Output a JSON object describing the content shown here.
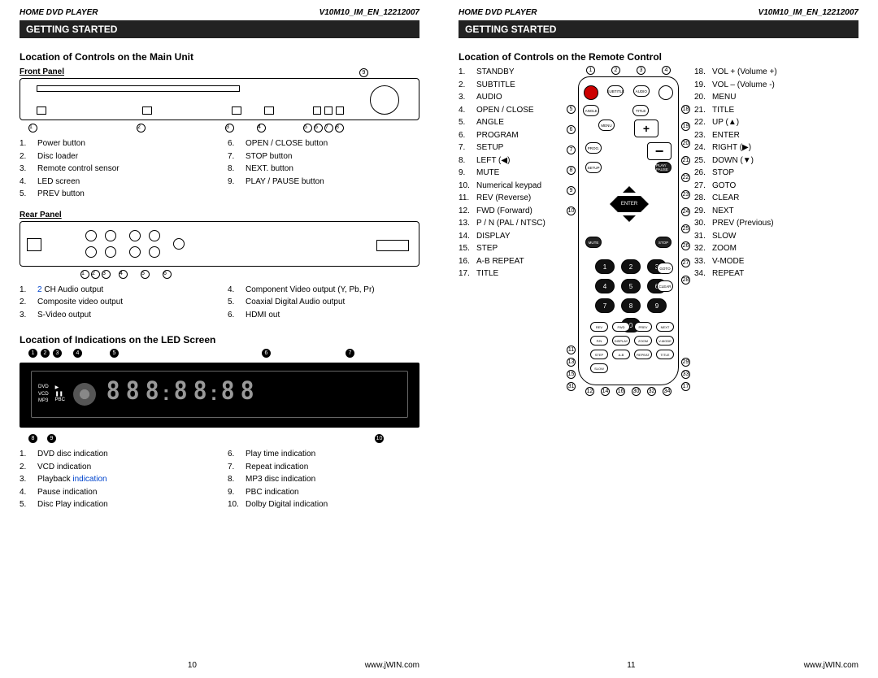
{
  "doc": {
    "product": "HOME DVD PLAYER",
    "docid": "V10M10_IM_EN_12212007",
    "band": "GETTING STARTED",
    "footer_url": "www.jWIN.com"
  },
  "left": {
    "title_main": "Location of Controls on the Main Unit",
    "front_label": "Front Panel",
    "front_list_a": [
      "Power button",
      "Disc loader",
      "Remote control sensor",
      "LED screen",
      "PREV button"
    ],
    "front_list_b": [
      "OPEN / CLOSE button",
      "STOP button",
      "NEXT. button",
      "PLAY / PAUSE button"
    ],
    "rear_label": "Rear Panel",
    "rear_list_a_1_pre": "2",
    "rear_list_a_1_post": " CH Audio output",
    "rear_list_a_rest": [
      "Composite video output",
      "S-Video output"
    ],
    "rear_list_b": [
      "Component Video output (Y, Pb, Pr)",
      "Coaxial Digital Audio output",
      "HDMI out"
    ],
    "led_title": "Location of Indications on the LED Screen",
    "led_tags": {
      "dvd": "DVD",
      "vcd": "VCD",
      "mp3": "MP3",
      "pbc": "PBC"
    },
    "led_list_a_12": [
      "DVD disc indication",
      "VCD indication"
    ],
    "led_list_a_3_pre": "Playback ",
    "led_list_a_3_link": "indication",
    "led_list_a_45": [
      "Pause indication",
      "Disc Play indication"
    ],
    "led_list_b": [
      "Play time indication",
      "Repeat indication",
      "MP3 disc indication",
      "PBC indication",
      "Dolby Digital indication"
    ],
    "page_no": "10"
  },
  "right": {
    "title_remote": "Location of Controls on the Remote Control",
    "list_left": [
      "STANDBY",
      "SUBTITLE",
      "AUDIO",
      "OPEN / CLOSE",
      "ANGLE",
      "PROGRAM",
      "SETUP",
      "LEFT (◀)",
      "MUTE",
      "Numerical keypad",
      "REV (Reverse)",
      "FWD (Forward)",
      "P / N (PAL / NTSC)",
      "DISPLAY",
      "STEP",
      "A-B REPEAT",
      "TITLE"
    ],
    "list_right": [
      "VOL + (Volume +)",
      "VOL – (Volume -)",
      "MENU",
      "TITLE",
      "UP (▲)",
      "ENTER",
      "RIGHT (▶)",
      "DOWN (▼)",
      "STOP",
      "GOTO",
      "CLEAR",
      "NEXT",
      "PREV (Previous)",
      "SLOW",
      "ZOOM",
      "V-MODE",
      "REPEAT"
    ],
    "btn": {
      "standby": "STANDBY",
      "subtitle": "SUBTITLE",
      "audio": "AUDIO",
      "open": "OPEN/\nCLOSE",
      "angle": "ANGLE",
      "title_s": "TITLE",
      "volp": "VOL+",
      "menu": "MENU",
      "voln": "VOL-",
      "prog": "PROG.",
      "setup": "SETUP",
      "play": "PLAY/\nPAUSE",
      "enter": "ENTER",
      "mute": "MUTE",
      "stop": "STOP",
      "clear": "CLEAR",
      "goto": "GOTO",
      "rev": "REV",
      "fwd": "FWD",
      "prev": "PREV",
      "next": "NEXT",
      "pn": "P/N",
      "display": "DISPLAY",
      "zoom": "ZOOM",
      "vmode": "V-MODE",
      "step": "STEP",
      "ab": "A-B",
      "repeat": "REPEAT",
      "title2": "TITLE",
      "slow": "SLOW"
    },
    "page_no": "11"
  }
}
